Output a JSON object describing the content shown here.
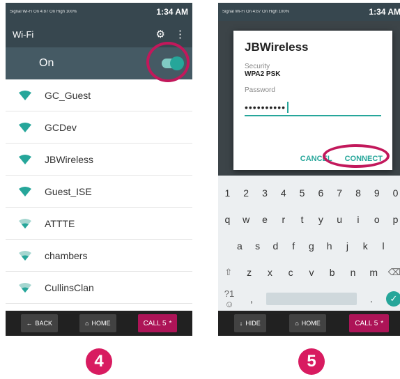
{
  "screen4": {
    "status": {
      "left": "Signal  Wi-Fi On  4:87 On  High  100%",
      "time": "1:34 AM"
    },
    "appbar": {
      "title": "Wi-Fi"
    },
    "toggle_label": "On",
    "networks": [
      {
        "name": "GC_Guest"
      },
      {
        "name": "GCDev"
      },
      {
        "name": "JBWireless"
      },
      {
        "name": "Guest_ISE"
      },
      {
        "name": "ATTTE"
      },
      {
        "name": "chambers"
      },
      {
        "name": "CullinsClan"
      }
    ],
    "nav": {
      "back": "BACK",
      "home": "HOME",
      "call": "CALL 5"
    },
    "step": "4"
  },
  "screen5": {
    "status": {
      "left": "Signal  Wi-Fi On  4:87 On  High  100%",
      "time": "1:34 AM"
    },
    "dialog": {
      "title": "JBWireless",
      "security_label": "Security",
      "security_value": "WPA2 PSK",
      "password_label": "Password",
      "password_value": "••••••••••",
      "cancel": "CANCEL",
      "connect": "CONNECT"
    },
    "keyboard": {
      "row1": [
        "1",
        "2",
        "3",
        "4",
        "5",
        "6",
        "7",
        "8",
        "9",
        "0"
      ],
      "row2": [
        "q",
        "w",
        "e",
        "r",
        "t",
        "y",
        "u",
        "i",
        "o",
        "p"
      ],
      "row3": [
        "a",
        "s",
        "d",
        "f",
        "g",
        "h",
        "j",
        "k",
        "l"
      ],
      "row4": [
        "z",
        "x",
        "c",
        "v",
        "b",
        "n",
        "m"
      ],
      "sym": "?1☺",
      "comma": ",",
      "period": "."
    },
    "nav": {
      "hide": "HIDE",
      "home": "HOME",
      "call": "CALL 5"
    },
    "step": "5"
  },
  "colors": {
    "accent": "#26a69a",
    "highlight": "#c2185b",
    "toolbar": "#37474f"
  }
}
